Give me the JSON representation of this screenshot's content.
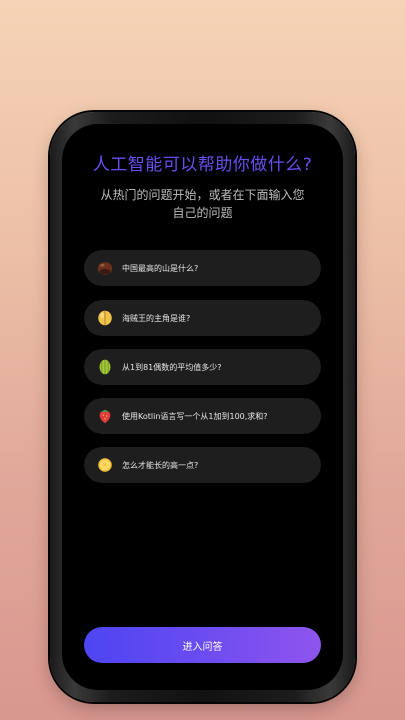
{
  "header": {
    "title": "人工智能可以帮助你做什么?",
    "subtitle": "从热门的问题开始，或者在下面输入您自己的问题"
  },
  "questions": [
    {
      "text": "中国最高的山是什么?",
      "icon": "chestnut-icon"
    },
    {
      "text": "海贼王的主角是谁?",
      "icon": "mango-icon"
    },
    {
      "text": "从1到81偶数的平均值多少?",
      "icon": "starfruit-icon"
    },
    {
      "text": "使用Kotlin语言写一个从1加到100,求和?",
      "icon": "strawberry-icon"
    },
    {
      "text": "怎么才能长的高一点?",
      "icon": "lemon-icon"
    }
  ],
  "footer": {
    "enter_label": "进入问答"
  },
  "colors": {
    "title": "#6a4df0",
    "button_start": "#4d45f2",
    "button_end": "#8f55ee",
    "item_bg": "#1e1e1e"
  }
}
